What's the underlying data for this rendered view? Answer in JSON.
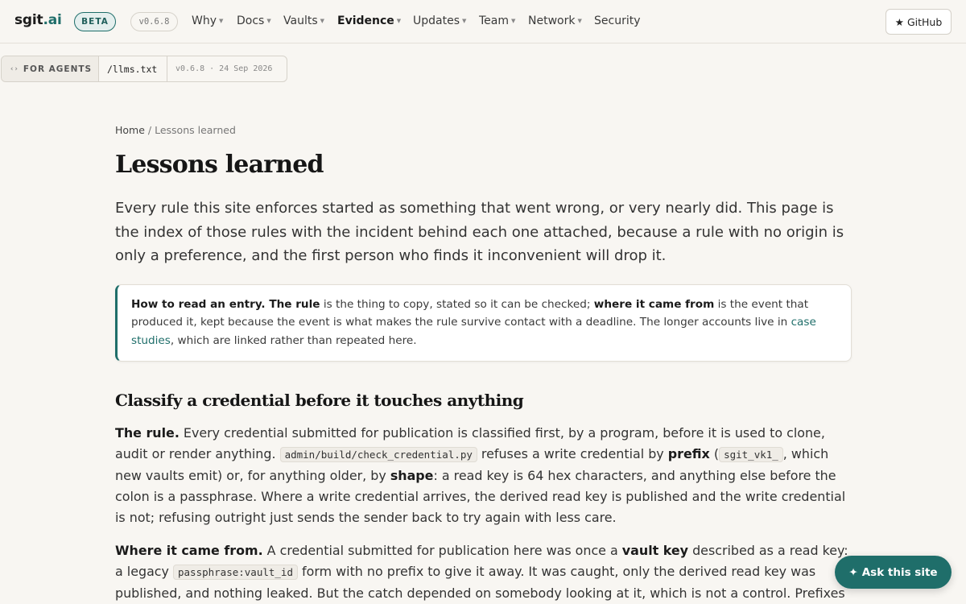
{
  "header": {
    "brand_main": "sgit",
    "brand_tld": ".ai",
    "beta_badge": "BETA",
    "version": "v0.6.8",
    "nav": [
      {
        "label": "Why",
        "dropdown": true
      },
      {
        "label": "Docs",
        "dropdown": true
      },
      {
        "label": "Vaults",
        "dropdown": true
      },
      {
        "label": "Evidence",
        "dropdown": true,
        "active": true
      },
      {
        "label": "Updates",
        "dropdown": true
      },
      {
        "label": "Team",
        "dropdown": true
      },
      {
        "label": "Network",
        "dropdown": true
      },
      {
        "label": "Security",
        "dropdown": false
      }
    ],
    "github_label": "GitHub",
    "github_icon": "star-icon"
  },
  "agents_bar": {
    "label": "FOR AGENTS",
    "icon": "code-chevrons-icon",
    "link": "/llms.txt",
    "version_date": "v0.6.8 · 24 Sep 2026"
  },
  "breadcrumb": {
    "home": "Home",
    "separator": " / ",
    "current": "Lessons learned"
  },
  "page": {
    "title": "Lessons learned",
    "lead": "Every rule this site enforces started as something that went wrong, or very nearly did. This page is the index of those rules with the incident behind each one attached, because a rule with no origin is only a preference, and the first person who finds it inconvenient will drop it."
  },
  "callout": {
    "bold1": "How to read an entry. The rule",
    "text1": " is the thing to copy, stated so it can be checked; ",
    "bold2": "where it came from",
    "text2": " is the event that produced it, kept because the event is what makes the rule survive contact with a deadline. The longer accounts live in ",
    "link": "case studies",
    "text3": ", which are linked rather than repeated here."
  },
  "section": {
    "heading": "Classify a credential before it touches anything",
    "rule_label": "The rule.",
    "rule_t1": " Every credential submitted for publication is classified first, by a program, before it is used to clone, audit or render anything. ",
    "rule_code1": "admin/build/check_credential.py",
    "rule_t2": " refuses a write credential by ",
    "rule_b1": "prefix",
    "rule_t3": " (",
    "rule_code2": "sgit_vk1_",
    "rule_t4": ", which new vaults emit) or, for anything older, by ",
    "rule_b2": "shape",
    "rule_t5": ": a read key is 64 hex characters, and anything else before the colon is a passphrase. Where a write credential arrives, the derived read key is published and the write credential is not; refusing outright just sends the sender back to try again with less care.",
    "origin_label": "Where it came from.",
    "origin_t1": " A credential submitted for publication here was once a ",
    "origin_b1": "vault key",
    "origin_t2": " described as a read key: a legacy ",
    "origin_code1": "passphrase:vault_id",
    "origin_t3": " form with no prefix to give it away. It was caught, only the derived read key was published, and nothing leaked. But the catch depended on somebody looking at it, which is not a control. Prefixes"
  },
  "ask_button": {
    "icon": "sparkle-icon",
    "label": "Ask this site"
  },
  "colors": {
    "accent": "#1f6e6a",
    "background": "#f8f6f2"
  }
}
